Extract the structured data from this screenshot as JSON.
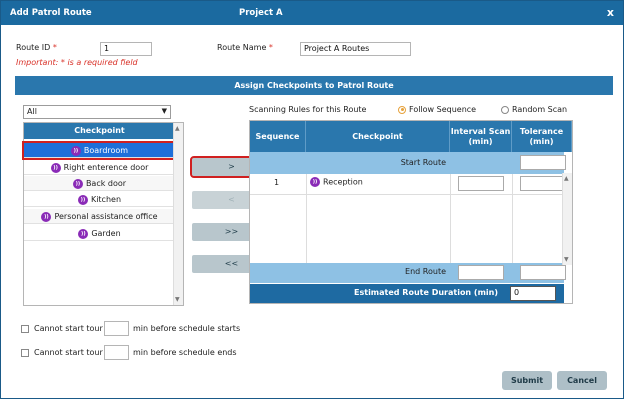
{
  "titlebar": {
    "title": "Add Patrol Route",
    "project": "Project A",
    "close": "x"
  },
  "form": {
    "route_id_label": "Route ID",
    "route_id_value": "1",
    "route_name_label": "Route Name",
    "route_name_value": "Project A Routes",
    "required_mark": "*",
    "important_note": "Important: * is a required field"
  },
  "assign": {
    "header": "Assign Checkpoints to Patrol Route",
    "filter_value": "All",
    "list_header": "Checkpoint",
    "items": [
      {
        "label": "Boardroom",
        "selected": true
      },
      {
        "label": "Right enterence door"
      },
      {
        "label": "Back door"
      },
      {
        "label": "Kitchen"
      },
      {
        "label": "Personal assistance office"
      },
      {
        "label": "Garden"
      }
    ],
    "buttons": {
      "add": ">",
      "remove": "<",
      "add_all": ">>",
      "remove_all": "<<"
    }
  },
  "rules": {
    "label": "Scanning Rules for this Route",
    "follow_sequence": "Follow Sequence",
    "random_scan": "Random Scan",
    "selected": "follow_sequence"
  },
  "route_table": {
    "columns": [
      "Sequence",
      "Checkpoint",
      "Interval Scan (min)",
      "Tolerance (min)"
    ],
    "start_label": "Start Route",
    "end_label": "End Route",
    "rows": [
      {
        "sequence": "1",
        "checkpoint": "Reception"
      }
    ],
    "duration_label": "Estimated Route Duration (min)",
    "duration_value": "0"
  },
  "options": {
    "start_prefix": "Cannot start tour",
    "start_suffix": "min before schedule starts",
    "end_prefix": "Cannot start tour",
    "end_suffix": "min before schedule ends"
  },
  "footer": {
    "submit": "Submit",
    "cancel": "Cancel"
  },
  "colors": {
    "header_blue": "#2a77ad",
    "title_blue": "#1b6aa0",
    "band_blue": "#8ec1e4",
    "selected_blue": "#1e6fd9",
    "required_red": "#d9332a",
    "nfc_purple": "#8a2bb7",
    "radio_orange": "#e6a23c"
  },
  "icons": {
    "nfc": "nfc-tag-icon",
    "caret": "chevron-down-icon"
  }
}
